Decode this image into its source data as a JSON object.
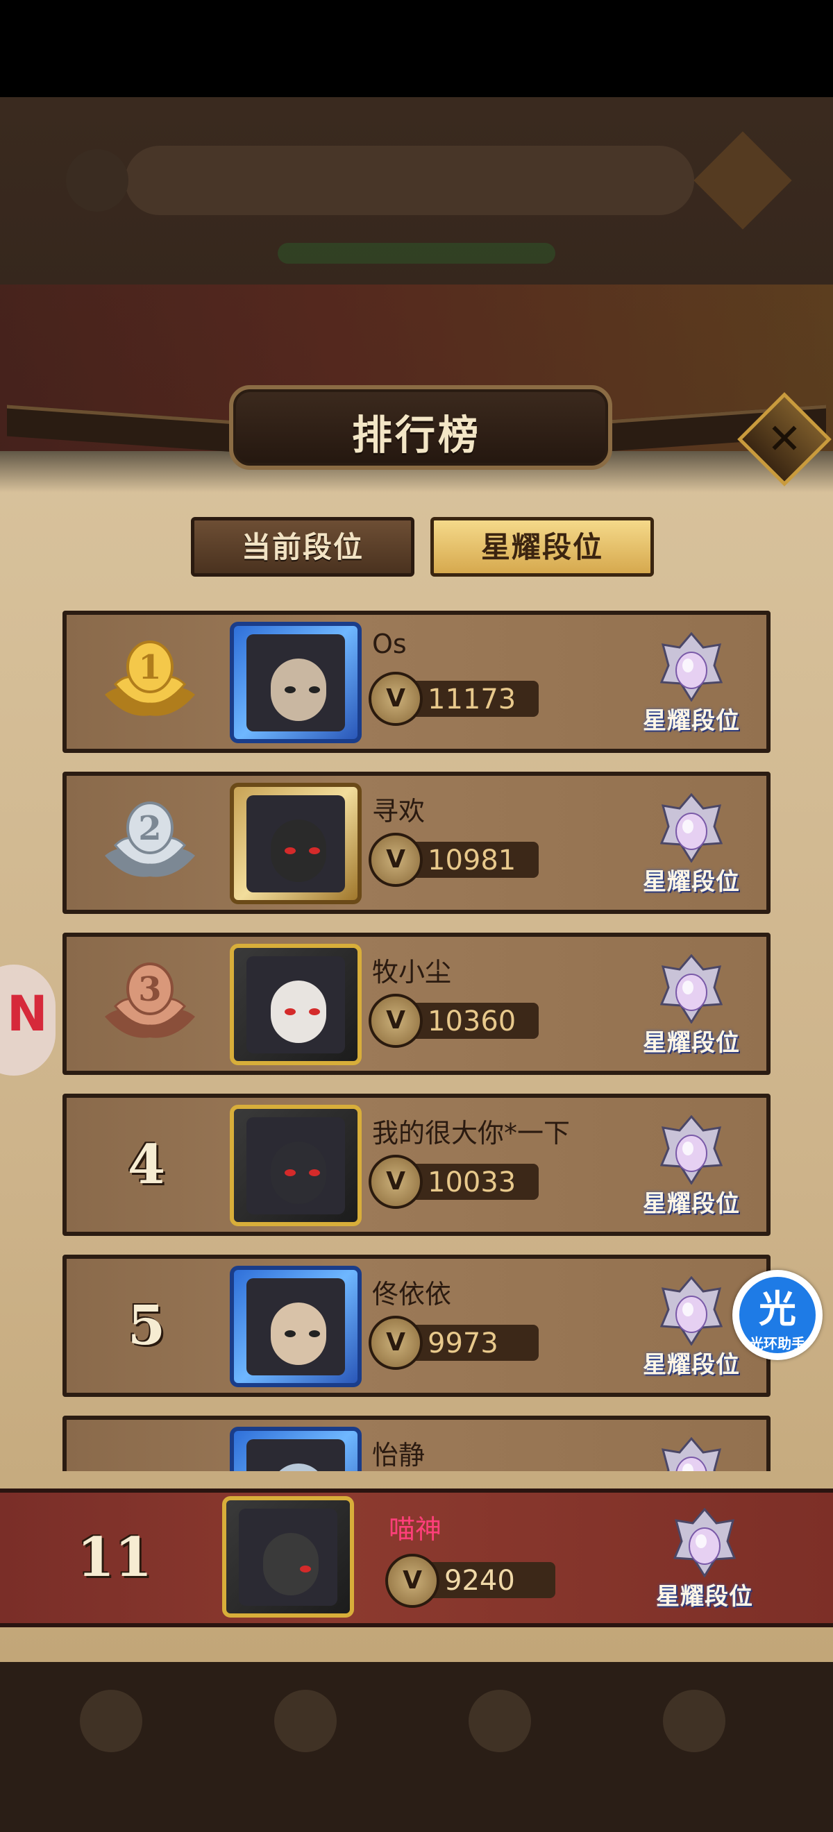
{
  "panel": {
    "title": "排行榜"
  },
  "tabs": [
    {
      "label": "当前段位",
      "selected": false
    },
    {
      "label": "星耀段位",
      "selected": true
    }
  ],
  "leaderboard": [
    {
      "rank": "1",
      "medal": "gold-medal",
      "name": "Os",
      "score": "11173",
      "tier": "星耀段位",
      "frame": "blue"
    },
    {
      "rank": "2",
      "medal": "silver-medal",
      "name": "寻欢",
      "score": "10981",
      "tier": "星耀段位",
      "frame": "gold"
    },
    {
      "rank": "3",
      "medal": "bronze-medal",
      "name": "牧小尘",
      "score": "10360",
      "tier": "星耀段位",
      "frame": "dark"
    },
    {
      "rank": "4",
      "medal": "",
      "name": "我的很大你*一下",
      "score": "10033",
      "tier": "星耀段位",
      "frame": "dark"
    },
    {
      "rank": "5",
      "medal": "",
      "name": "佟依依",
      "score": "9973",
      "tier": "星耀段位",
      "frame": "blue"
    },
    {
      "rank": "",
      "medal": "",
      "name": "怡静",
      "score": "",
      "tier": "",
      "frame": "blue"
    }
  ],
  "self": {
    "rank": "11",
    "name": "喵神",
    "score": "9240",
    "tier": "星耀段位"
  },
  "helper": {
    "glyph": "光",
    "label": "光环助手"
  },
  "colors": {
    "selfName": "#ff3f7a",
    "tabActive": "#e8c06a",
    "rowBg": "#9c7a58"
  }
}
